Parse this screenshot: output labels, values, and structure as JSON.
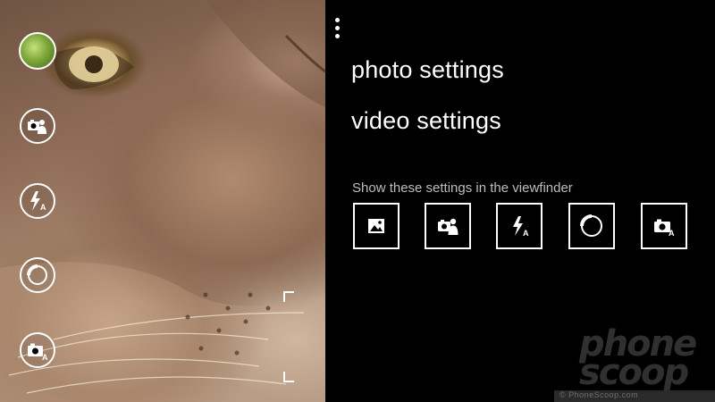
{
  "menu": {
    "items": [
      {
        "label": "photo settings"
      },
      {
        "label": "video settings"
      }
    ]
  },
  "viewfinder_settings": {
    "label": "Show these settings in the viewfinder",
    "toggles": [
      {
        "icon": "photo-mode-icon"
      },
      {
        "icon": "scene-portrait-icon"
      },
      {
        "icon": "flash-auto-icon"
      },
      {
        "icon": "focus-assist-icon"
      },
      {
        "icon": "camera-auto-icon"
      }
    ]
  },
  "viewfinder": {
    "buttons": [
      {
        "icon": "last-photo-thumbnail"
      },
      {
        "icon": "scene-portrait-icon"
      },
      {
        "icon": "flash-auto-icon"
      },
      {
        "icon": "focus-assist-icon"
      },
      {
        "icon": "camera-auto-icon"
      }
    ],
    "flash_badge": "A",
    "camera_badge": "A"
  },
  "watermark": {
    "line1": "phone",
    "line2": "scoop",
    "credit": "© PhoneScoop.com"
  }
}
